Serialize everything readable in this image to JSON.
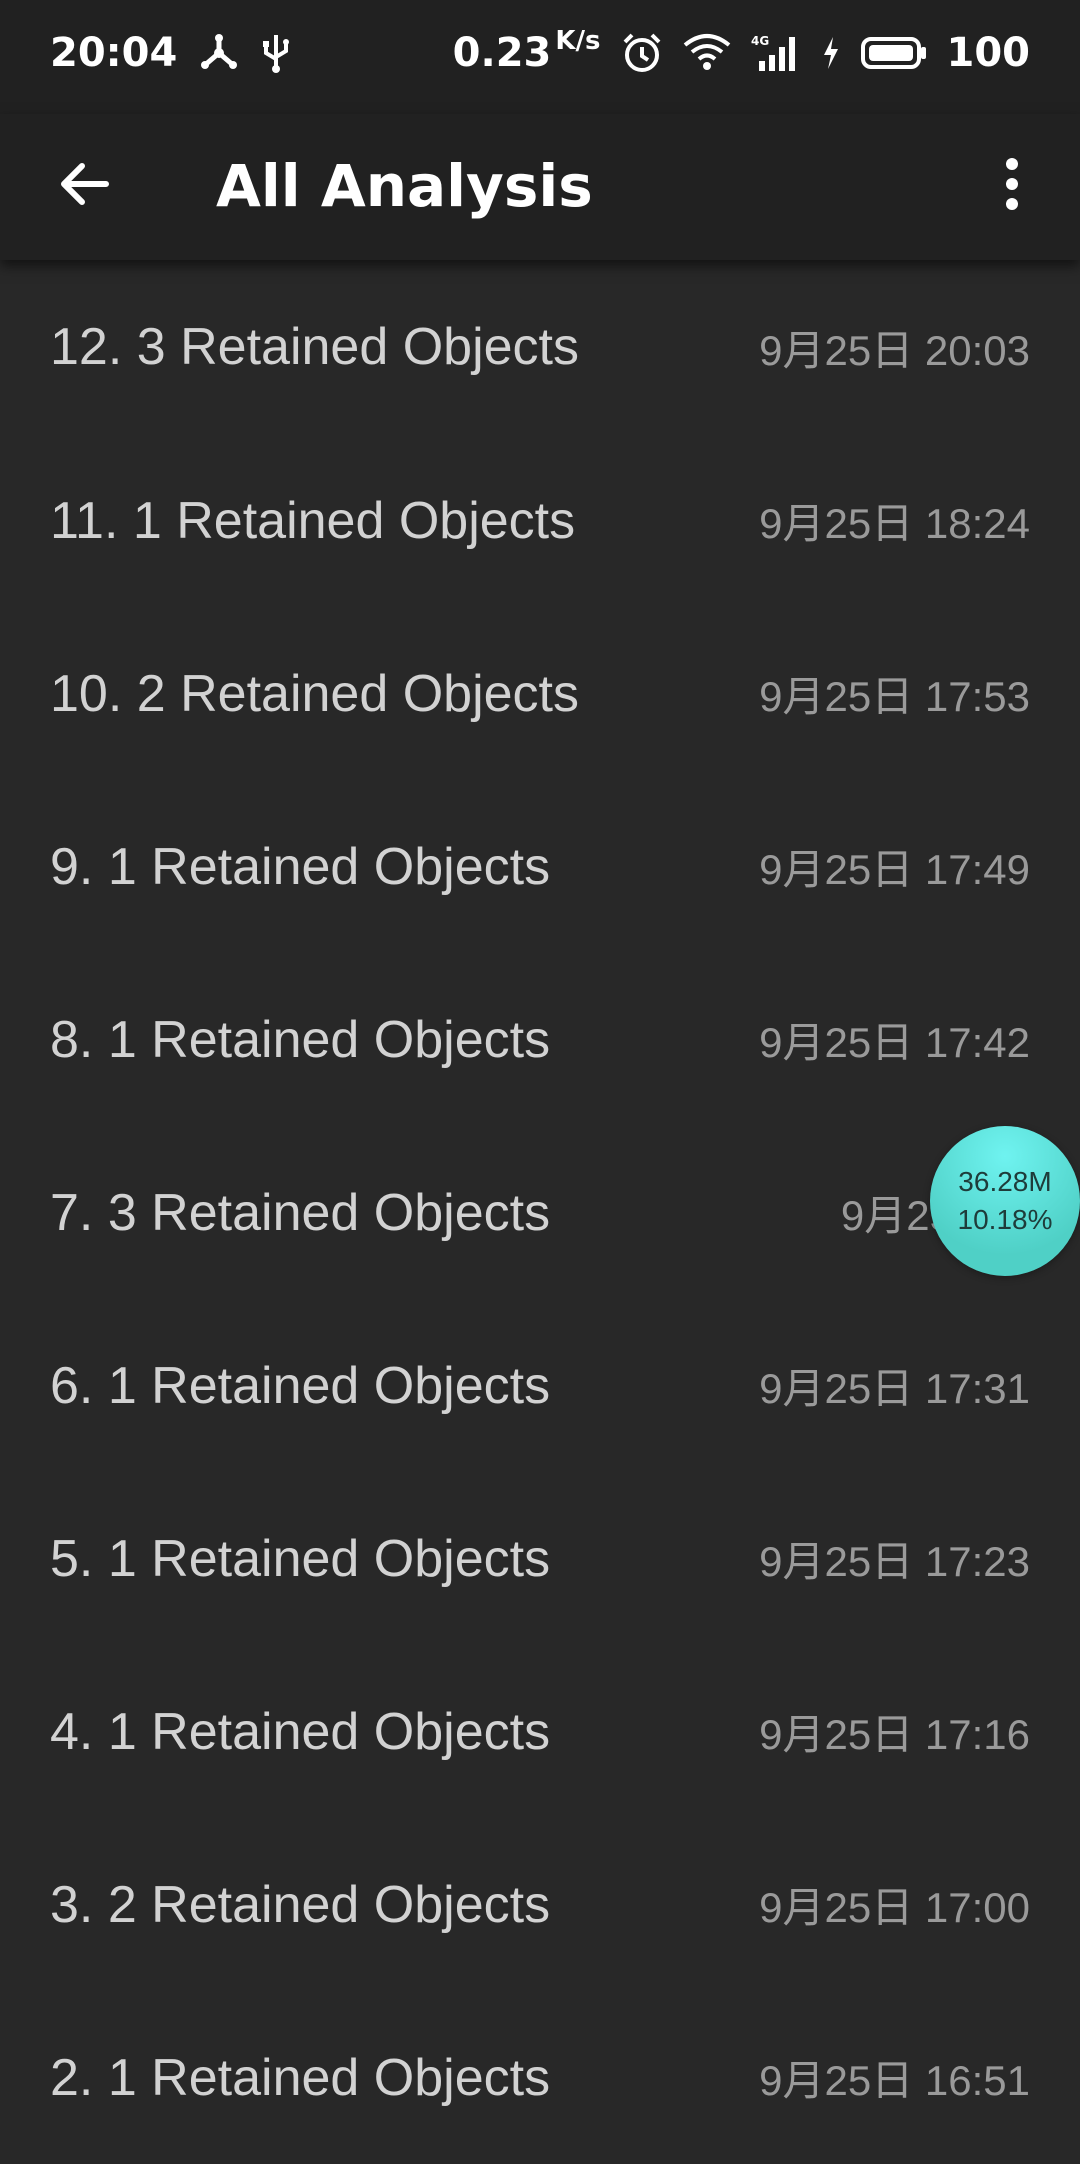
{
  "status_bar": {
    "time": "20:04",
    "net_speed_value": "0.23",
    "net_speed_unit": "K/s",
    "battery_level": "100",
    "network_type": "4G"
  },
  "app_bar": {
    "title": "All Analysis"
  },
  "analyses": [
    {
      "title": "12. 3 Retained Objects",
      "time": "9月25日 20:03"
    },
    {
      "title": "11. 1 Retained Objects",
      "time": "9月25日 18:24"
    },
    {
      "title": "10. 2 Retained Objects",
      "time": "9月25日 17:53"
    },
    {
      "title": "9. 1 Retained Objects",
      "time": "9月25日 17:49"
    },
    {
      "title": "8. 1 Retained Objects",
      "time": "9月25日 17:42"
    },
    {
      "title": "7. 3 Retained Objects",
      "time": "9月25日 1"
    },
    {
      "title": "6. 1 Retained Objects",
      "time": "9月25日 17:31"
    },
    {
      "title": "5. 1 Retained Objects",
      "time": "9月25日 17:23"
    },
    {
      "title": "4. 1 Retained Objects",
      "time": "9月25日 17:16"
    },
    {
      "title": "3. 2 Retained Objects",
      "time": "9月25日 17:00"
    },
    {
      "title": "2. 1 Retained Objects",
      "time": "9月25日 16:51"
    }
  ],
  "float_monitor": {
    "memory": "36.28M",
    "cpu": "10.18%"
  },
  "colors": {
    "background": "#282828",
    "app_bar": "#212121",
    "title_text": "#d2d2d2",
    "time_text": "#9a9a9a",
    "bubble": "#5fe0d8"
  }
}
